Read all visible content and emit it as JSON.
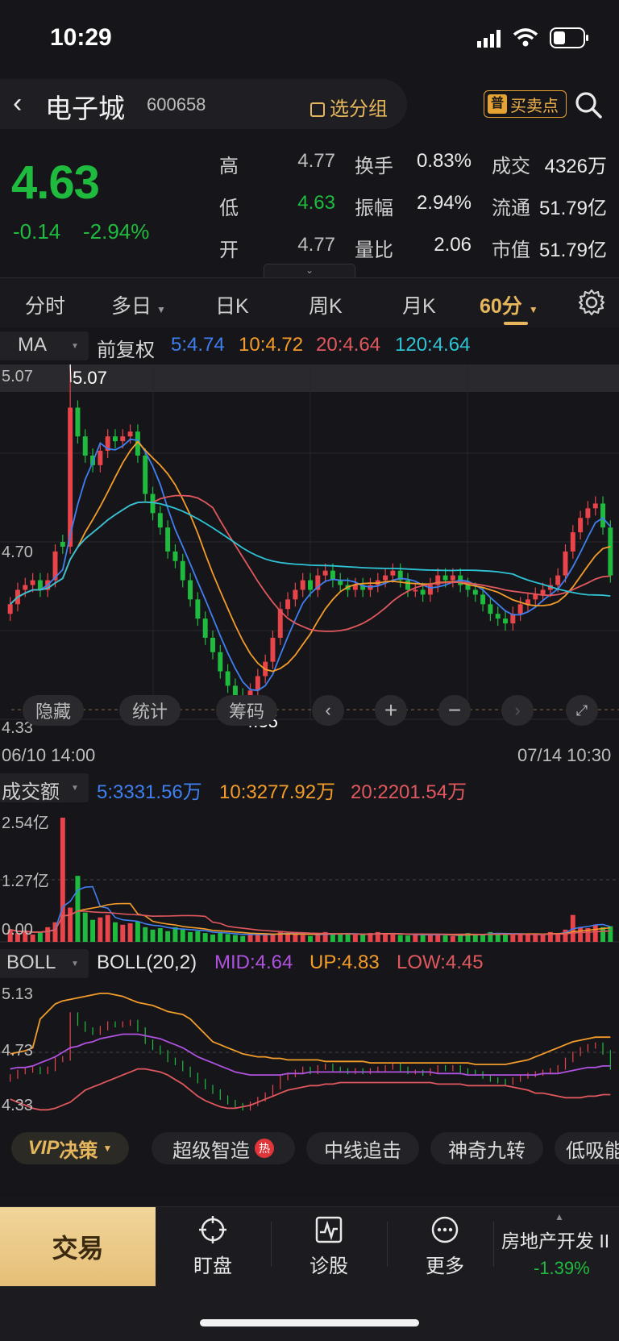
{
  "status": {
    "time": "10:29"
  },
  "header": {
    "stock_name": "电子城",
    "stock_code": "600658",
    "group_label": "选分组",
    "buysell_badge": "普",
    "buysell_label": "买卖点"
  },
  "quote": {
    "price": "4.63",
    "change": "-0.14",
    "change_pct": "-2.94%",
    "high_label": "高",
    "high": "4.77",
    "low_label": "低",
    "low": "4.63",
    "open_label": "开",
    "open": "4.77",
    "turnover_label": "换手",
    "turnover": "0.83%",
    "amplitude_label": "振幅",
    "amplitude": "2.94%",
    "volratio_label": "量比",
    "volratio": "2.06",
    "volume_label": "成交",
    "volume": "4326万",
    "float_label": "流通",
    "float": "51.79亿",
    "mcap_label": "市值",
    "mcap": "51.79亿"
  },
  "tabs": [
    "分时",
    "多日",
    "日K",
    "周K",
    "月K",
    "60分"
  ],
  "active_tab": "60分",
  "ma_bar": {
    "selector": "MA",
    "adjust": "前复权",
    "ma5": "5:4.74",
    "ma10": "10:4.72",
    "ma20": "20:4.64",
    "ma120": "120:4.64"
  },
  "colors": {
    "up": "#e8444a",
    "down": "#1fbb3e",
    "ma5": "#3f7ff0",
    "ma10": "#f39c2a",
    "ma20": "#e0585e",
    "ma120": "#2ec4d6",
    "mid": "#b052e0",
    "gold": "#e6b65c"
  },
  "chart_controls": {
    "hide": "隐藏",
    "stats": "统计",
    "chips": "筹码"
  },
  "chart_data": [
    {
      "type": "candlestick",
      "title": "60分",
      "x_start": "06/10 14:00",
      "x_end": "07/14 10:30",
      "y_axis_labels": [
        "5.07",
        "4.70",
        "4.33"
      ],
      "ylim": [
        4.33,
        5.07
      ],
      "max_marker": "5.07",
      "min_marker": "4.35",
      "close": [
        4.57,
        4.6,
        4.61,
        4.62,
        4.6,
        4.62,
        4.68,
        4.69,
        4.98,
        4.92,
        4.88,
        4.86,
        4.89,
        4.92,
        4.91,
        4.92,
        4.93,
        4.88,
        4.8,
        4.76,
        4.73,
        4.68,
        4.66,
        4.62,
        4.58,
        4.54,
        4.5,
        4.47,
        4.43,
        4.4,
        4.38,
        4.36,
        4.39,
        4.42,
        4.45,
        4.5,
        4.56,
        4.58,
        4.6,
        4.62,
        4.6,
        4.63,
        4.64,
        4.62,
        4.61,
        4.6,
        4.61,
        4.6,
        4.61,
        4.62,
        4.63,
        4.64,
        4.62,
        4.6,
        4.6,
        4.59,
        4.61,
        4.63,
        4.62,
        4.63,
        4.61,
        4.6,
        4.59,
        4.57,
        4.55,
        4.54,
        4.53,
        4.55,
        4.57,
        4.58,
        4.59,
        4.6,
        4.61,
        4.63,
        4.68,
        4.72,
        4.75,
        4.77,
        4.78,
        4.73,
        4.63
      ]
    },
    {
      "type": "bar",
      "title": "成交额",
      "ma5": "5:3331.56万",
      "ma10": "10:3277.92万",
      "ma20": "20:2201.54万",
      "y_axis_labels": [
        "2.54亿",
        "1.27亿",
        "0.00"
      ],
      "ylim": [
        0,
        2.54
      ],
      "values": [
        0.25,
        0.18,
        0.22,
        0.15,
        0.2,
        0.3,
        0.4,
        2.54,
        0.7,
        1.35,
        0.6,
        0.45,
        0.5,
        0.55,
        0.4,
        0.35,
        0.38,
        0.42,
        0.3,
        0.25,
        0.28,
        0.22,
        0.3,
        0.25,
        0.2,
        0.22,
        0.18,
        0.15,
        0.2,
        0.16,
        0.14,
        0.12,
        0.15,
        0.18,
        0.16,
        0.14,
        0.2,
        0.18,
        0.16,
        0.14,
        0.12,
        0.15,
        0.2,
        0.18,
        0.16,
        0.15,
        0.14,
        0.16,
        0.18,
        0.2,
        0.16,
        0.15,
        0.14,
        0.13,
        0.15,
        0.16,
        0.14,
        0.15,
        0.13,
        0.12,
        0.14,
        0.18,
        0.16,
        0.15,
        0.2,
        0.18,
        0.16,
        0.14,
        0.15,
        0.16,
        0.14,
        0.15,
        0.2,
        0.18,
        0.25,
        0.55,
        0.3,
        0.28,
        0.35,
        0.3,
        0.32
      ]
    },
    {
      "type": "line",
      "title": "BOLL",
      "params": "BOLL(20,2)",
      "mid": "MID:4.64",
      "up": "UP:4.83",
      "low": "LOW:4.45",
      "y_axis_labels": [
        "5.13",
        "4.73",
        "4.33"
      ],
      "ylim": [
        4.33,
        5.13
      ],
      "series": [
        {
          "name": "UP",
          "values": [
            4.72,
            4.73,
            4.74,
            4.76,
            4.95,
            5.0,
            5.05,
            5.07,
            5.08,
            5.09,
            5.1,
            5.11,
            5.12,
            5.12,
            5.11,
            5.1,
            5.08,
            5.06,
            5.05,
            5.04,
            5.02,
            5.0,
            4.99,
            4.98,
            4.95,
            4.9,
            4.85,
            4.8,
            4.78,
            4.76,
            4.74,
            4.72,
            4.71,
            4.7,
            4.7,
            4.69,
            4.69,
            4.68,
            4.68,
            4.68,
            4.68,
            4.68,
            4.67,
            4.67,
            4.67,
            4.67,
            4.67,
            4.67,
            4.66,
            4.66,
            4.66,
            4.66,
            4.66,
            4.66,
            4.66,
            4.66,
            4.66,
            4.66,
            4.66,
            4.66,
            4.66,
            4.66,
            4.65,
            4.65,
            4.65,
            4.65,
            4.65,
            4.66,
            4.67,
            4.68,
            4.7,
            4.72,
            4.74,
            4.76,
            4.78,
            4.8,
            4.81,
            4.82,
            4.83,
            4.83,
            4.83
          ]
        },
        {
          "name": "MID",
          "values": [
            4.62,
            4.63,
            4.63,
            4.64,
            4.66,
            4.68,
            4.7,
            4.73,
            4.76,
            4.77,
            4.79,
            4.8,
            4.82,
            4.83,
            4.84,
            4.85,
            4.85,
            4.85,
            4.84,
            4.83,
            4.82,
            4.8,
            4.78,
            4.76,
            4.73,
            4.7,
            4.68,
            4.66,
            4.64,
            4.62,
            4.6,
            4.59,
            4.58,
            4.58,
            4.58,
            4.58,
            4.58,
            4.59,
            4.59,
            4.59,
            4.6,
            4.6,
            4.6,
            4.6,
            4.6,
            4.6,
            4.6,
            4.6,
            4.6,
            4.6,
            4.6,
            4.6,
            4.6,
            4.6,
            4.6,
            4.6,
            4.6,
            4.59,
            4.59,
            4.59,
            4.59,
            4.58,
            4.58,
            4.58,
            4.58,
            4.58,
            4.58,
            4.58,
            4.58,
            4.58,
            4.58,
            4.59,
            4.59,
            4.59,
            4.6,
            4.61,
            4.62,
            4.63,
            4.63,
            4.64,
            4.64
          ]
        },
        {
          "name": "LOW",
          "values": [
            4.42,
            4.4,
            4.38,
            4.36,
            4.35,
            4.35,
            4.36,
            4.38,
            4.4,
            4.44,
            4.48,
            4.5,
            4.52,
            4.54,
            4.56,
            4.58,
            4.6,
            4.62,
            4.62,
            4.61,
            4.6,
            4.58,
            4.55,
            4.52,
            4.48,
            4.44,
            4.41,
            4.39,
            4.37,
            4.36,
            4.36,
            4.37,
            4.38,
            4.4,
            4.42,
            4.44,
            4.46,
            4.48,
            4.49,
            4.5,
            4.51,
            4.51,
            4.52,
            4.52,
            4.53,
            4.53,
            4.53,
            4.53,
            4.53,
            4.53,
            4.53,
            4.53,
            4.53,
            4.53,
            4.53,
            4.53,
            4.53,
            4.52,
            4.52,
            4.52,
            4.52,
            4.51,
            4.51,
            4.51,
            4.51,
            4.51,
            4.51,
            4.5,
            4.49,
            4.48,
            4.46,
            4.46,
            4.45,
            4.44,
            4.43,
            4.43,
            4.43,
            4.44,
            4.44,
            4.45,
            4.45
          ]
        }
      ]
    }
  ],
  "strip": {
    "vip_prefix": "VIP",
    "vip_label": "决策",
    "chips": [
      "超级智造",
      "中线追击",
      "神奇九转",
      "低吸能"
    ],
    "hot": "热"
  },
  "bottom": {
    "trade": "交易",
    "items": [
      "盯盘",
      "诊股",
      "更多"
    ],
    "industry": "房地产开发 II",
    "industry_pct": "-1.39%"
  }
}
